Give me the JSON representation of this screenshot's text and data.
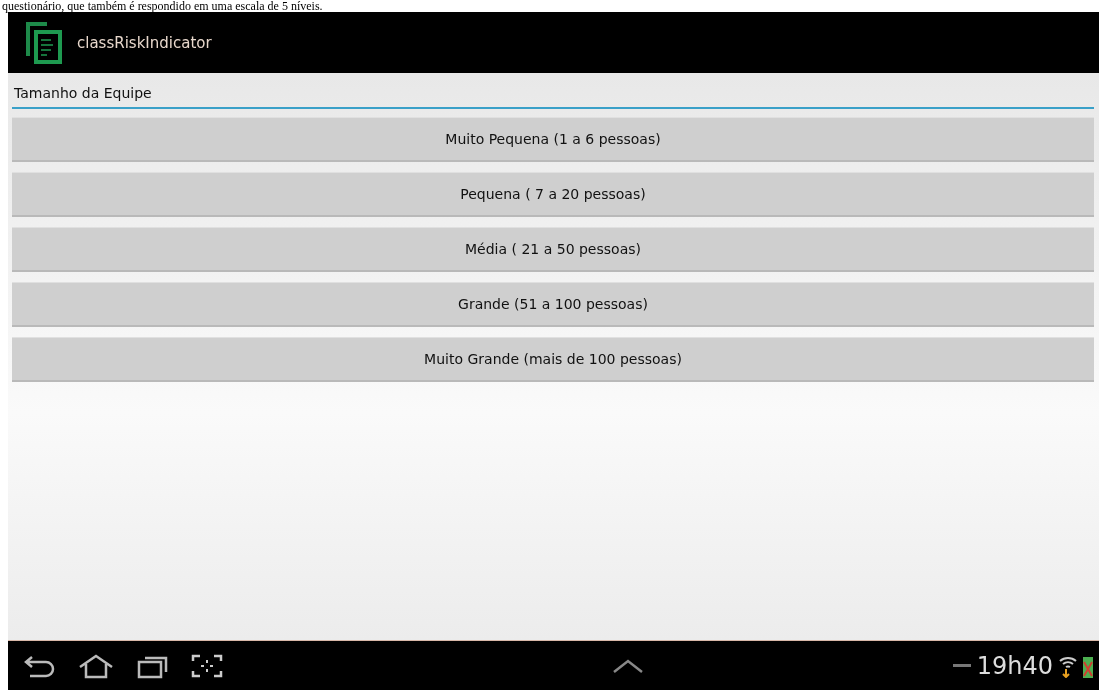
{
  "document_caption": "questionário, que também é respondido em uma escala de 5 níveis.",
  "action_bar": {
    "title": "classRiskIndicator"
  },
  "section": {
    "title": "Tamanho da Equipe"
  },
  "options": [
    {
      "label": "Muito Pequena (1 a 6 pessoas)"
    },
    {
      "label": "Pequena ( 7 a 20 pessoas)"
    },
    {
      "label": "Média ( 21 a 50 pessoas)"
    },
    {
      "label": "Grande (51 a 100 pessoas)"
    },
    {
      "label": "Muito Grande (mais de 100 pessoas)"
    }
  ],
  "system_bar": {
    "clock": "19h40"
  }
}
